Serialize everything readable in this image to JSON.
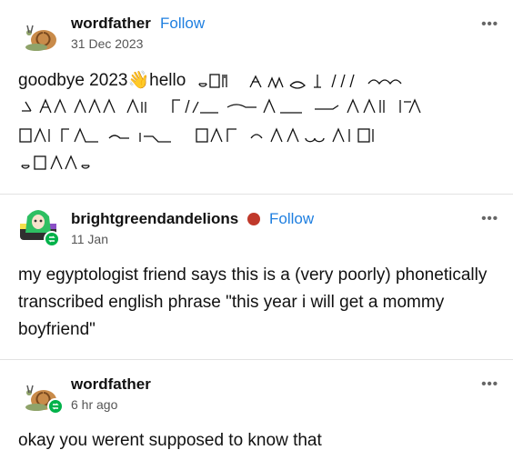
{
  "posts": [
    {
      "username": "wordfather",
      "follow": "Follow",
      "date": "31 Dec 2023",
      "text_prefix": "goodbye 2023",
      "text_wave": "👋",
      "text_hello": "hello",
      "more": "•••"
    },
    {
      "username": "brightgreendandelions",
      "follow": "Follow",
      "date": "11 Jan",
      "text": "my egyptologist friend says this is a (very poorly) phonetically transcribed english phrase \"this year i will get a mommy boyfriend\"",
      "more": "•••"
    },
    {
      "username": "wordfather",
      "date": "6 hr ago",
      "text": "okay you werent supposed to know that",
      "more": "•••"
    }
  ],
  "colors": {
    "follow": "#1f7fe0",
    "reblog": "#00b24a",
    "divider": "#e2e2e2"
  },
  "icons": [
    "snail-avatar",
    "anime-avatar",
    "reblog-icon",
    "more-icon",
    "hieroglyph-text"
  ]
}
